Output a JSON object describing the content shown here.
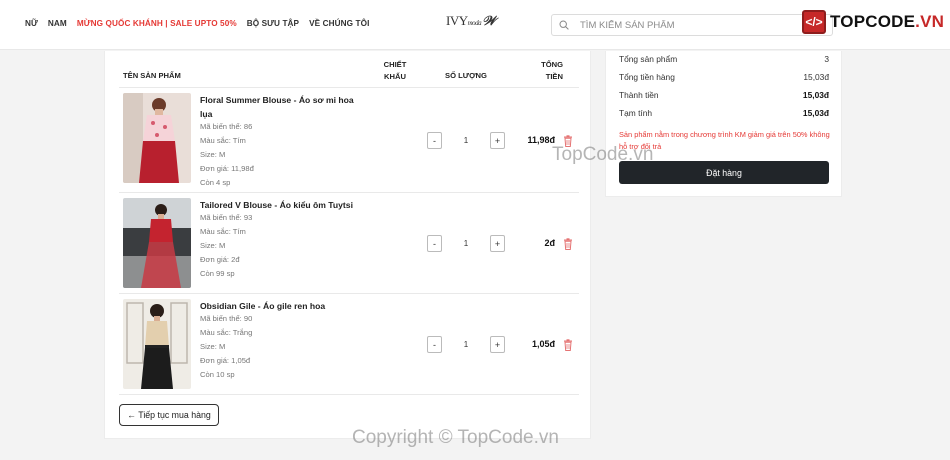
{
  "nav": {
    "items": [
      "NỮ",
      "NAM",
      "MỪNG QUỐC KHÁNH | SALE UPTO 50%",
      "BỘ SƯU TẬP",
      "VỀ CHÚNG TÔI"
    ]
  },
  "logo": {
    "text": "IVY",
    "sub": "moda"
  },
  "search": {
    "placeholder": "TÌM KIẾM SẢN PHẨM"
  },
  "brand": {
    "prefix": "TOPCODE",
    "suffix": ".VN"
  },
  "cart": {
    "headers": {
      "product": "TÊN SẢN PHẨM",
      "discount_1": "CHIẾT",
      "discount_2": "KHẤU",
      "quantity": "SỐ LƯỢNG",
      "total_1": "TỔNG",
      "total_2": "TIỀN"
    },
    "items": [
      {
        "name": "Floral Summer Blouse - Áo sơ mi hoa lụa",
        "variant": "Mã biến thể: 86",
        "color": "Màu sắc: Tím",
        "size": "Size: M",
        "price": "Đơn giá: 11,98đ",
        "stock": "Còn 4 sp",
        "qty": "1",
        "total": "11,98đ"
      },
      {
        "name": "Tailored V Blouse - Áo kiểu ôm Tuytsi",
        "variant": "Mã biến thể: 93",
        "color": "Màu sắc: Tím",
        "size": "Size: M",
        "price": "Đơn giá: 2đ",
        "stock": "Còn 99 sp",
        "qty": "1",
        "total": "2đ"
      },
      {
        "name": "Obsidian Gile - Áo gile ren hoa",
        "variant": "Mã biến thể: 90",
        "color": "Màu sắc: Trắng",
        "size": "Size: M",
        "price": "Đơn giá: 1,05đ",
        "stock": "Còn 10 sp",
        "qty": "1",
        "total": "1,05đ"
      }
    ],
    "continue_label": "← Tiếp tục mua hàng"
  },
  "summary": {
    "rows": [
      {
        "label": "Tổng sản phẩm",
        "value": "3"
      },
      {
        "label": "Tổng tiền hàng",
        "value": "15,03đ"
      },
      {
        "label": "Thành tiền",
        "value": "15,03đ"
      },
      {
        "label": "Tạm tính",
        "value": "15,03đ"
      }
    ],
    "note": "Sản phẩm nằm trong chương trình KM giảm giá trên 50% không hỗ trợ đổi trả",
    "order_label": "Đặt hàng"
  },
  "watermarks": {
    "center": "TopCode.vn",
    "bottom": "Copyright © TopCode.vn"
  },
  "colors": {
    "sale": "#e53935",
    "button": "#212529",
    "brand_red": "#c62828"
  }
}
